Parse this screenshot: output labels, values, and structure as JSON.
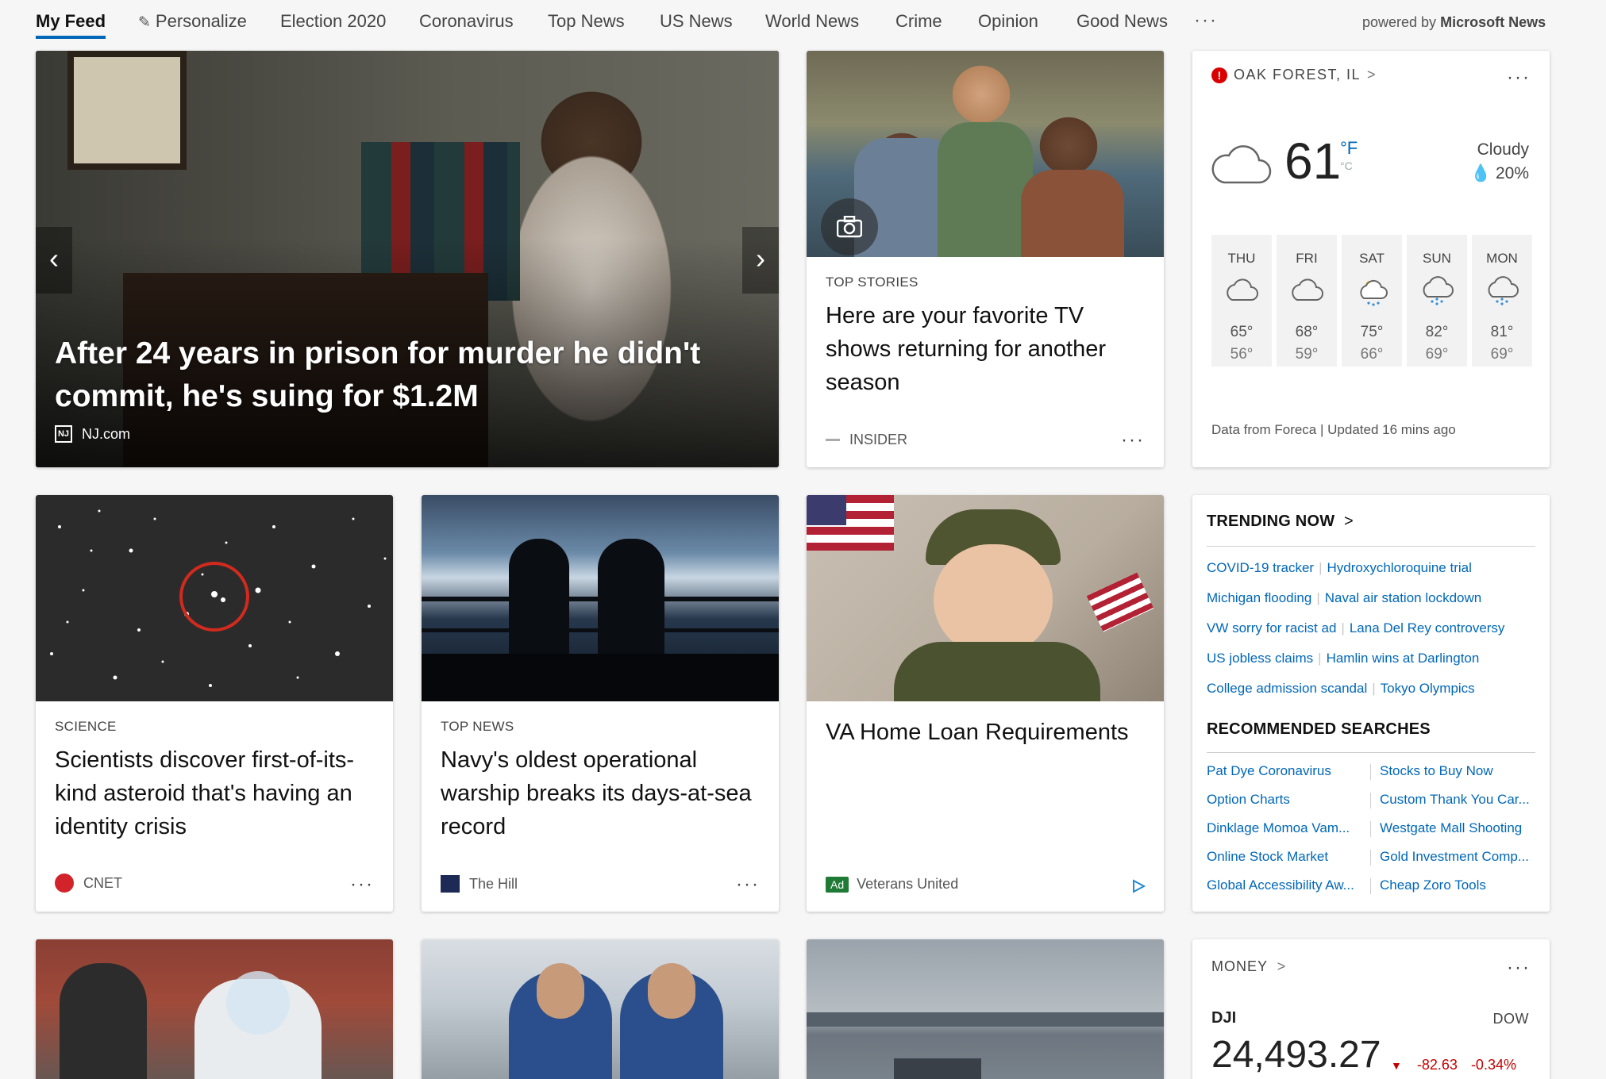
{
  "nav": {
    "items": [
      "My Feed",
      "Personalize",
      "Election 2020",
      "Coronavirus",
      "Top News",
      "US News",
      "World News",
      "Crime",
      "Opinion",
      "Good News"
    ],
    "more": "···",
    "powered_prefix": "powered by",
    "powered_brand": "Microsoft News"
  },
  "hero": {
    "title": "After 24 years in prison for murder he didn't commit, he's suing for $1.2M",
    "source": "NJ.com",
    "source_logo": "NJ",
    "dot_count": 30,
    "active_dot": 18,
    "prev_icon": "chevron-left-icon",
    "next_icon": "chevron-right-icon",
    "more": "···"
  },
  "top_story": {
    "category": "TOP STORIES",
    "title": "Here are your favorite TV shows returning for another season",
    "source": "INSIDER",
    "more": "···"
  },
  "weather": {
    "location": "OAK FOREST, IL",
    "location_chevron": ">",
    "alert_mark": "!",
    "more": "···",
    "temp": "61",
    "unit_f": "°F",
    "unit_c": "°C",
    "condition": "Cloudy",
    "precip": "20%",
    "forecast": [
      {
        "day": "THU",
        "icon": "cloud-icon",
        "hi": "65°",
        "lo": "56°"
      },
      {
        "day": "FRI",
        "icon": "cloud-icon",
        "hi": "68°",
        "lo": "59°"
      },
      {
        "day": "SAT",
        "icon": "sun-rain-icon",
        "hi": "75°",
        "lo": "66°"
      },
      {
        "day": "SUN",
        "icon": "rain-icon",
        "hi": "82°",
        "lo": "69°"
      },
      {
        "day": "MON",
        "icon": "rain-icon",
        "hi": "81°",
        "lo": "69°"
      }
    ],
    "footer": "Data from Foreca | Updated 16 mins ago"
  },
  "articles": [
    {
      "category": "SCIENCE",
      "title": "Scientists discover first-of-its-kind asteroid that's having an identity crisis",
      "source": "CNET",
      "more": "···"
    },
    {
      "category": "TOP NEWS",
      "title": "Navy's oldest operational warship breaks its days-at-sea record",
      "source": "The Hill",
      "more": "···"
    }
  ],
  "ad": {
    "title": "VA Home Loan Requirements",
    "badge": "Ad",
    "source": "Veterans United"
  },
  "trending": {
    "heading": "TRENDING NOW",
    "chevron": ">",
    "rows": [
      [
        "COVID-19 tracker",
        "Hydroxychloroquine trial"
      ],
      [
        "Michigan flooding",
        "Naval air station lockdown"
      ],
      [
        "VW sorry for racist ad",
        "Lana Del Rey controversy"
      ],
      [
        "US jobless claims",
        "Hamlin wins at Darlington"
      ],
      [
        "College admission scandal",
        "Tokyo Olympics"
      ]
    ],
    "rec_heading": "RECOMMENDED SEARCHES",
    "recommended": [
      [
        "Pat Dye Coronavirus",
        "Stocks to Buy Now"
      ],
      [
        "Option Charts",
        "Custom Thank You Car..."
      ],
      [
        "Dinklage Momoa Vam...",
        "Westgate Mall Shooting"
      ],
      [
        "Online Stock Market",
        "Gold Investment Comp..."
      ],
      [
        "Global Accessibility Aw...",
        "Cheap Zoro Tools"
      ]
    ]
  },
  "money": {
    "label": "MONEY",
    "chevron": ">",
    "more": "···",
    "symbol": "DJI",
    "index": "DOW",
    "value": "24,493.27",
    "change": "-82.63",
    "change_pct": "-0.34%",
    "trend_icon": "down-triangle-icon"
  },
  "colors": {
    "accent": "#0067b8",
    "alert": "#d90000",
    "negative": "#c40000",
    "ad": "#1f7a36"
  }
}
